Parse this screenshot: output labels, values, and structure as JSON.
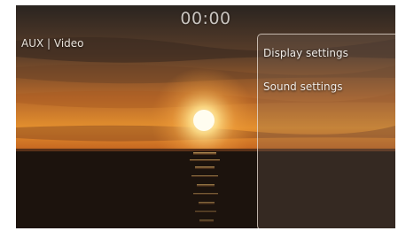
{
  "status_bar": {
    "clock": "00:00"
  },
  "source": {
    "label": "AUX | Video"
  },
  "menu": {
    "items": [
      {
        "label": "Display settings"
      },
      {
        "label": "Sound settings"
      }
    ]
  },
  "background": {
    "description_icon": "sunset-video-frame",
    "colors": {
      "sky_top": "#2a1c14",
      "sky_glow": "#d9802a",
      "sun": "#fff4c8",
      "sea": "#1b1410"
    }
  }
}
